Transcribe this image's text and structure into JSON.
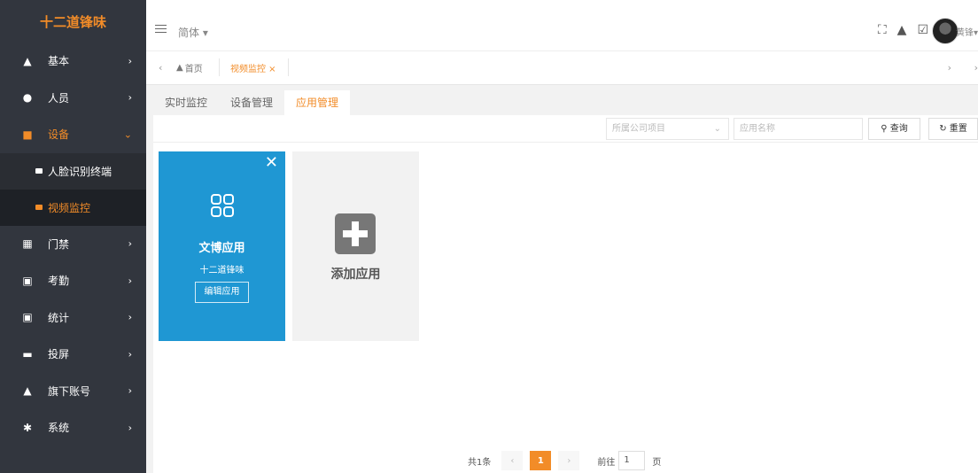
{
  "sidebar": {
    "logo": "十二道锋味",
    "items": [
      {
        "label": "基本",
        "icon": "home-icon"
      },
      {
        "label": "人员",
        "icon": "users-icon"
      },
      {
        "label": "设备",
        "icon": "camera-icon"
      },
      {
        "label": "门禁",
        "icon": "door-icon"
      },
      {
        "label": "考勤",
        "icon": "calendar-icon"
      },
      {
        "label": "统计",
        "icon": "calendar-icon"
      },
      {
        "label": "投屏",
        "icon": "monitor-icon"
      },
      {
        "label": "旗下账号",
        "icon": "home-icon"
      },
      {
        "label": "系统",
        "icon": "gear-icon"
      }
    ],
    "sub_items": [
      {
        "label": "人脸识别终端"
      },
      {
        "label": "视频监控"
      }
    ]
  },
  "header": {
    "language": "简体 ▾",
    "username": "黄锋▾"
  },
  "tabbar": {
    "home": "首页",
    "active_tab": "视频监控 ×"
  },
  "subtabs": [
    "实时监控",
    "设备管理",
    "应用管理"
  ],
  "filters": {
    "company_placeholder": "所属公司项目",
    "name_placeholder": "应用名称",
    "query_label": "查询",
    "reset_label": "重置"
  },
  "cards": {
    "app_title": "文博应用",
    "app_sub": "十二道锋味",
    "edit_label": "编辑应用",
    "add_label": "添加应用"
  },
  "pagination": {
    "total": "共1条",
    "current_page": "1",
    "goto_label": "前往",
    "goto_value": "1",
    "page_unit": "页"
  },
  "colors": {
    "accent": "#f28c28",
    "sidebar_bg": "#32363e",
    "card_blue": "#1f97d3"
  }
}
